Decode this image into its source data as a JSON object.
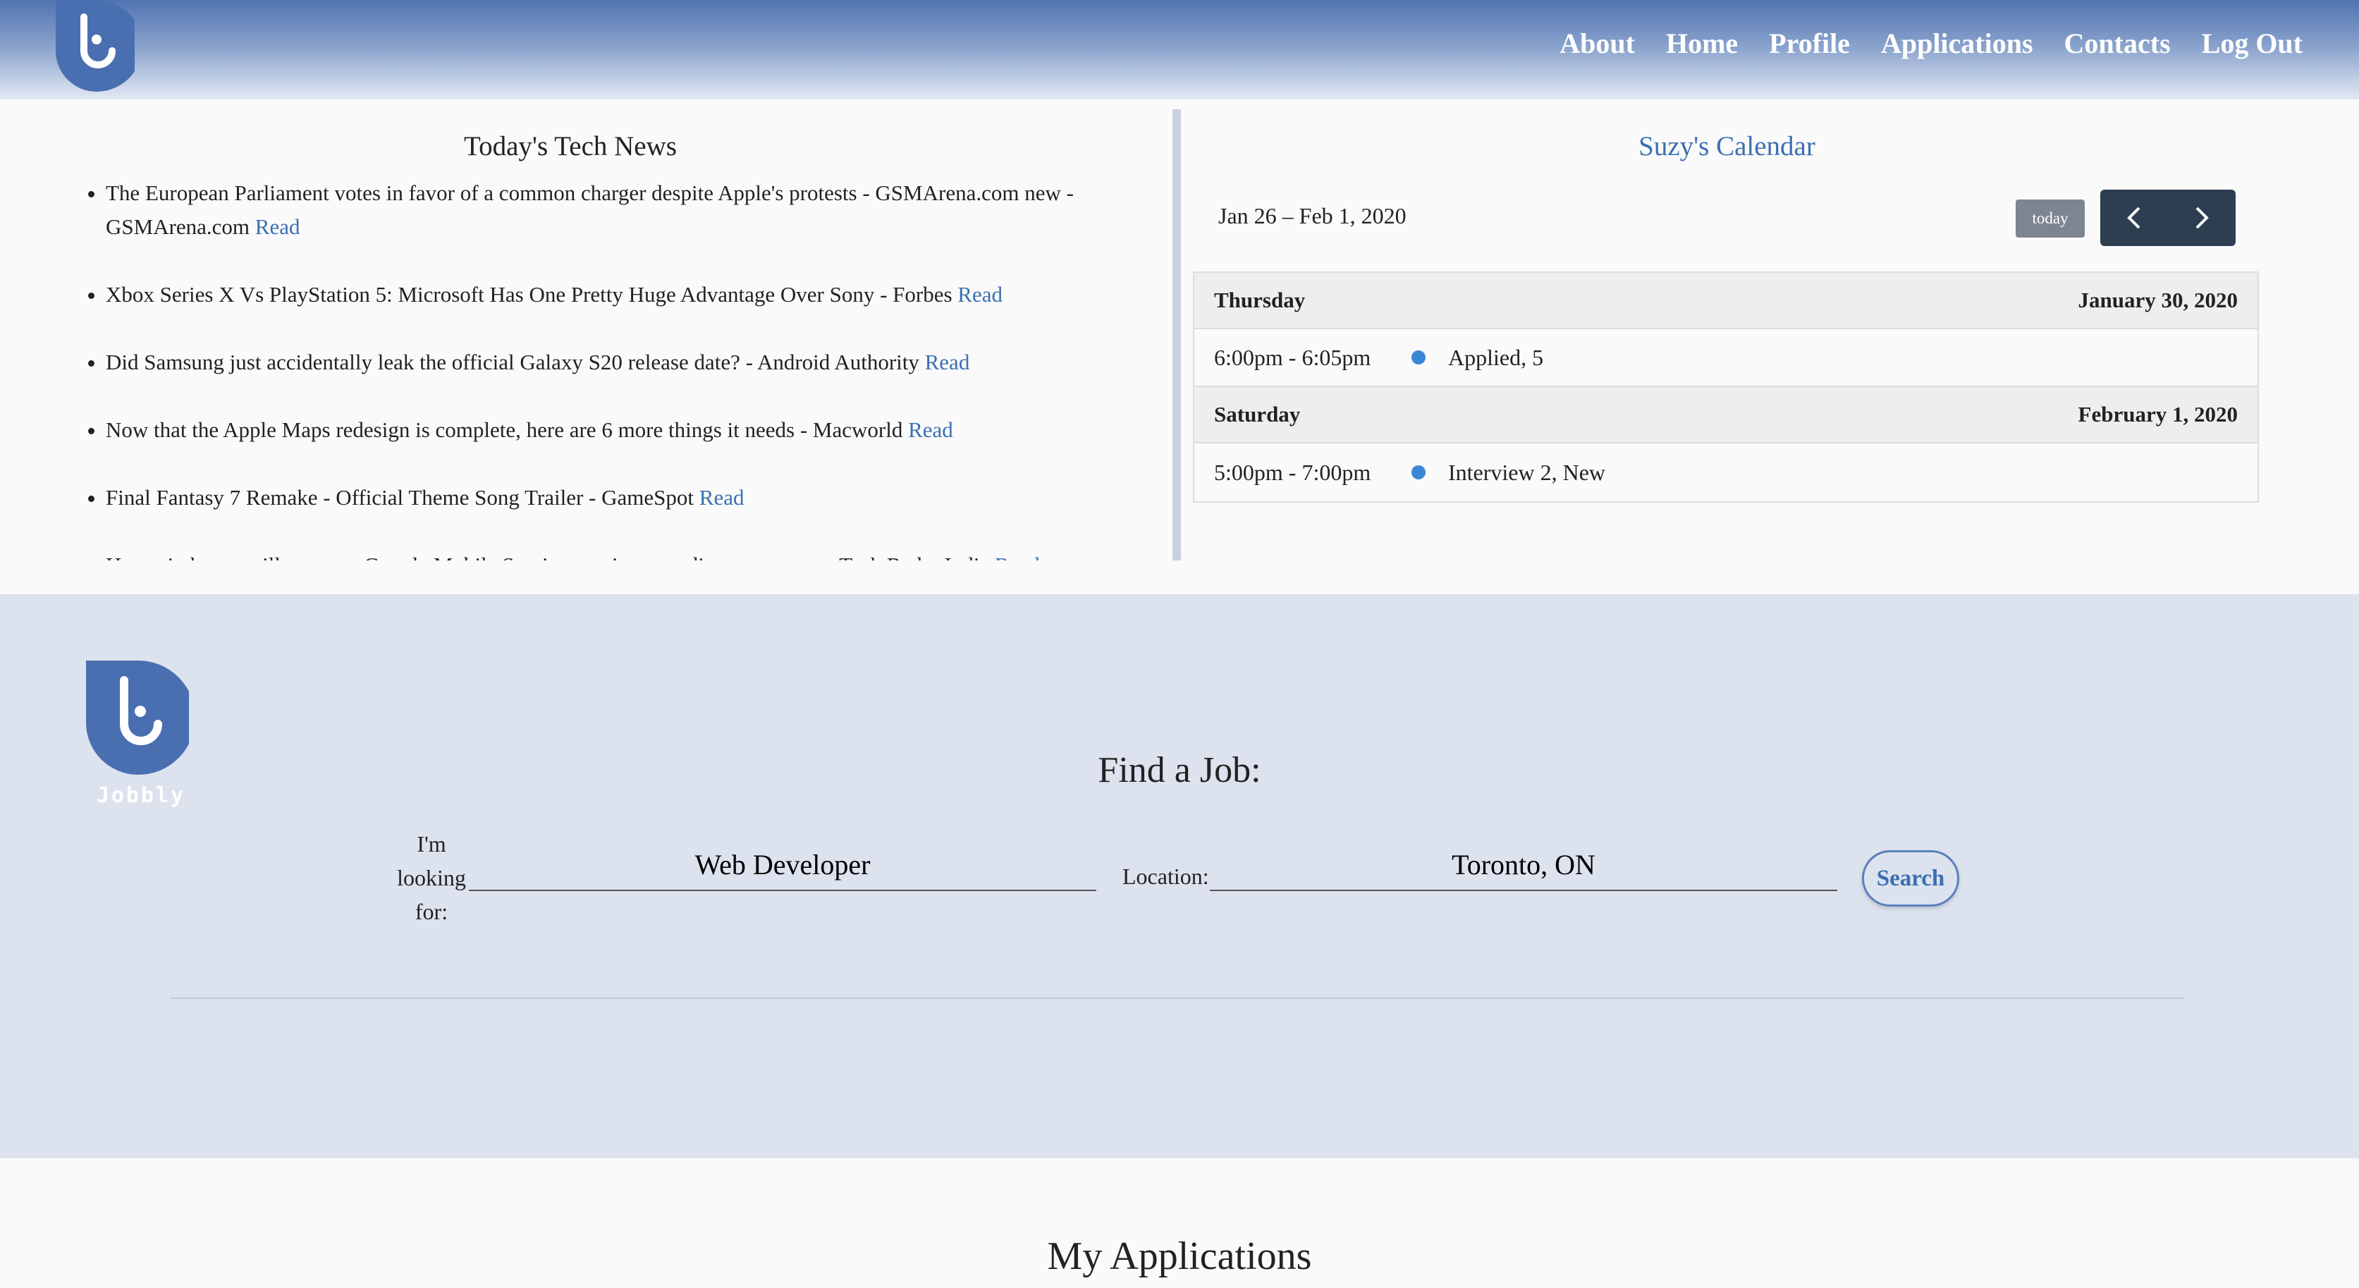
{
  "header": {
    "nav": [
      "About",
      "Home",
      "Profile",
      "Applications",
      "Contacts",
      "Log Out"
    ]
  },
  "news": {
    "title": "Today's Tech News",
    "read_label": "Read",
    "items": [
      "The European Parliament votes in favor of a common charger despite Apple's protests - GSMArena.com new - GSMArena.com",
      "Xbox Series X Vs PlayStation 5: Microsoft Has One Pretty Huge Advantage Over Sony - Forbes",
      "Did Samsung just accidentally leak the official Galaxy S20 release date? - Android Authority",
      "Now that the Apple Maps redesign is complete, here are 6 more things it needs - Macworld",
      "Final Fantasy 7 Remake - Official Theme Song Trailer - GameSpot",
      "Huawei phones will now run Google Mobile Services again, according to a report - Tech Radar India"
    ]
  },
  "calendar": {
    "title": "Suzy's Calendar",
    "range": "Jan 26 – Feb 1, 2020",
    "today_label": "today",
    "days": [
      {
        "day": "Thursday",
        "date": "January 30, 2020",
        "events": [
          {
            "time": "6:00pm - 6:05pm",
            "title": "Applied, 5"
          }
        ]
      },
      {
        "day": "Saturday",
        "date": "February 1, 2020",
        "events": [
          {
            "time": "5:00pm - 7:00pm",
            "title": "Interview 2, New"
          }
        ]
      }
    ],
    "event_color": "#3a87d6"
  },
  "find": {
    "logo_text": "Jobbly",
    "title": "Find a Job:",
    "looking_label": "I'm looking for:",
    "job_value": "Web Developer",
    "location_label": "Location:",
    "location_value": "Toronto, ON",
    "search_label": "Search"
  },
  "apps": {
    "title": "My Applications"
  },
  "colors": {
    "brand": "#4a6fb0",
    "link": "#3b6fb3",
    "find_bg": "#dce2ee"
  }
}
